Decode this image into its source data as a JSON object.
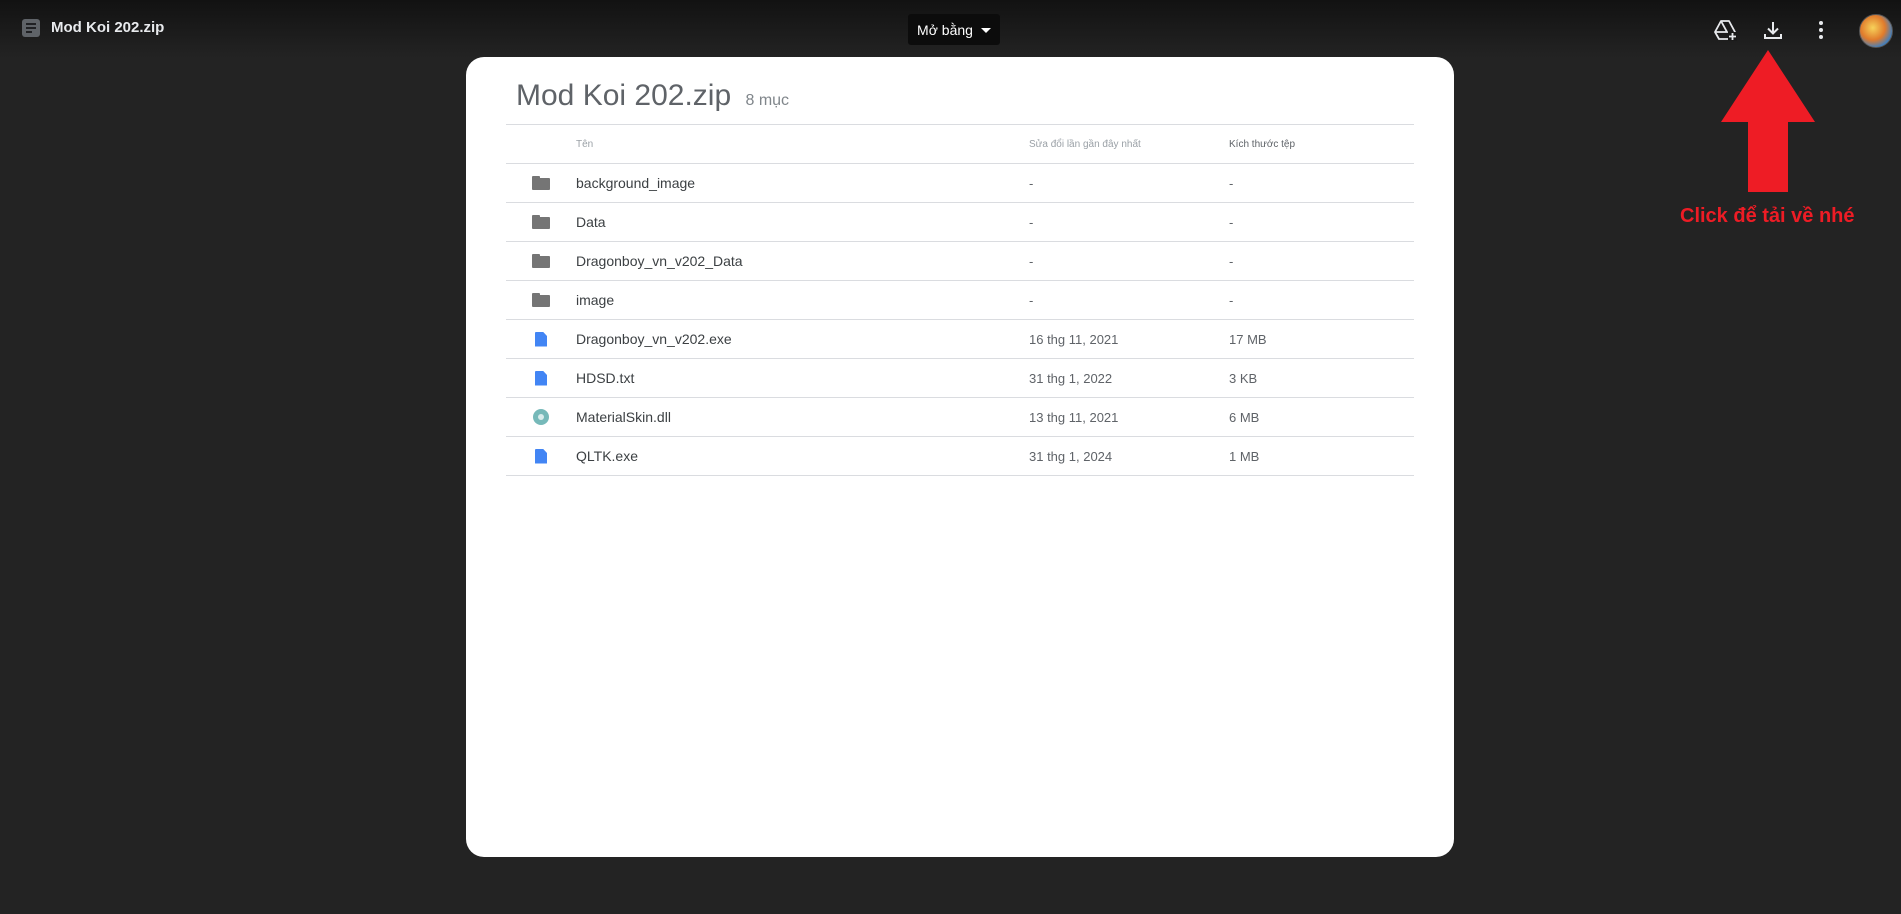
{
  "header": {
    "file_title": "Mod Koi 202.zip",
    "open_with_label": "Mở bằng",
    "icons": [
      "add-to-drive-icon",
      "download-icon",
      "more-options-icon"
    ],
    "avatar": "avatar"
  },
  "archive": {
    "title": "Mod Koi 202.zip",
    "item_count": "8 mục",
    "columns": {
      "name": "Tên",
      "modified": "Sửa đổi lần gần đây nhất",
      "size": "Kích thước tệp"
    },
    "rows": [
      {
        "icon": "folder-icon",
        "name": "background_image",
        "modified": "-",
        "size": "-"
      },
      {
        "icon": "folder-icon",
        "name": "Data",
        "modified": "-",
        "size": "-"
      },
      {
        "icon": "folder-icon",
        "name": "Dragonboy_vn_v202_Data",
        "modified": "-",
        "size": "-"
      },
      {
        "icon": "folder-icon",
        "name": "image",
        "modified": "-",
        "size": "-"
      },
      {
        "icon": "document-icon",
        "name": "Dragonboy_vn_v202.exe",
        "modified": "16 thg 11, 2021",
        "size": "17 MB"
      },
      {
        "icon": "document-icon",
        "name": "HDSD.txt",
        "modified": "31 thg 1, 2022",
        "size": "3 KB"
      },
      {
        "icon": "settings-file-icon",
        "name": "MaterialSkin.dll",
        "modified": "13 thg 11, 2021",
        "size": "6 MB"
      },
      {
        "icon": "document-icon",
        "name": "QLTK.exe",
        "modified": "31 thg 1, 2024",
        "size": "1 MB"
      }
    ]
  },
  "annotation": {
    "text": "Click để tải về nhé",
    "color": "#ee1c25"
  },
  "colors": {
    "background": "#232323",
    "card": "#ffffff",
    "doc_icon": "#4285f4",
    "folder_icon": "#757575"
  }
}
